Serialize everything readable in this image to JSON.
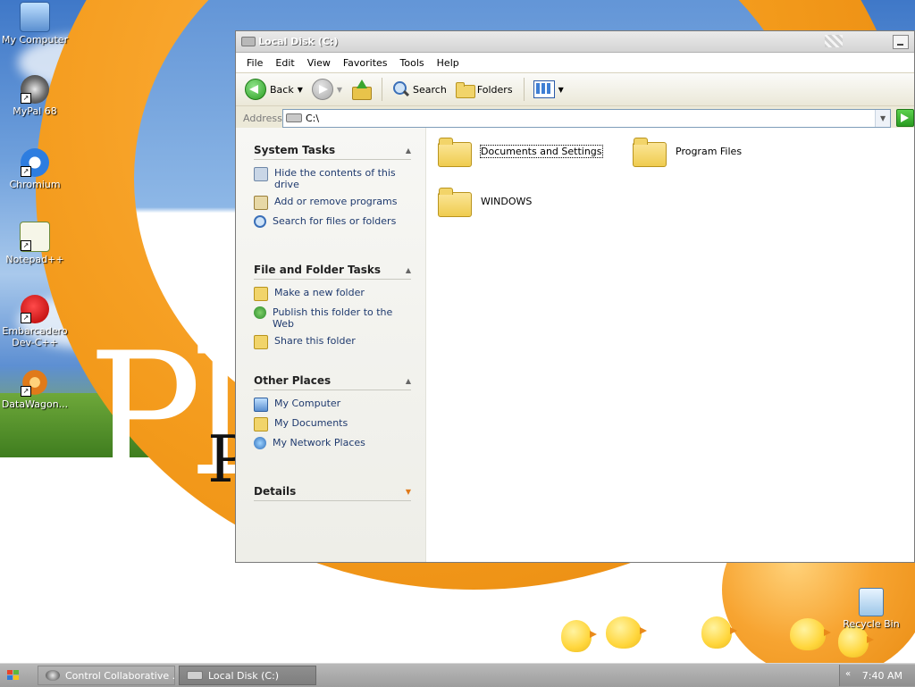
{
  "desktop": {
    "icons": [
      {
        "label": "My Computer"
      },
      {
        "label": "MyPal 68"
      },
      {
        "label": "Chromium"
      },
      {
        "label": "Notepad++"
      },
      {
        "label": "Embarcadero Dev-C++"
      },
      {
        "label": "DataWagon..."
      },
      {
        "label": "Recycle Bin"
      }
    ],
    "wallpaper_text_1": "Pl",
    "wallpaper_text_2": "P"
  },
  "window": {
    "title": "Local Disk (C:)",
    "menu": [
      "File",
      "Edit",
      "View",
      "Favorites",
      "Tools",
      "Help"
    ],
    "toolbar": {
      "back_label": "Back",
      "search_label": "Search",
      "folders_label": "Folders"
    },
    "address": {
      "label": "Address",
      "value": "C:\\"
    },
    "task_pane": {
      "system_tasks": {
        "title": "System Tasks",
        "items": [
          "Hide the contents of this drive",
          "Add or remove programs",
          "Search for files or folders"
        ]
      },
      "file_folder_tasks": {
        "title": "File and Folder Tasks",
        "items": [
          "Make a new folder",
          "Publish this folder to the Web",
          "Share this folder"
        ]
      },
      "other_places": {
        "title": "Other Places",
        "items": [
          "My Computer",
          "My Documents",
          "My Network Places"
        ]
      },
      "details": {
        "title": "Details"
      }
    },
    "files": [
      "Documents and Settings",
      "Program Files",
      "WINDOWS"
    ]
  },
  "taskbar": {
    "buttons": [
      {
        "label": "Control Collaborative ..."
      },
      {
        "label": "Local Disk (C:)"
      }
    ],
    "clock": "7:40 AM"
  },
  "colors": {
    "link_blue": "#1f3a6e",
    "title_text": "#ffffff",
    "folder_yellow": "#efcc4f"
  }
}
